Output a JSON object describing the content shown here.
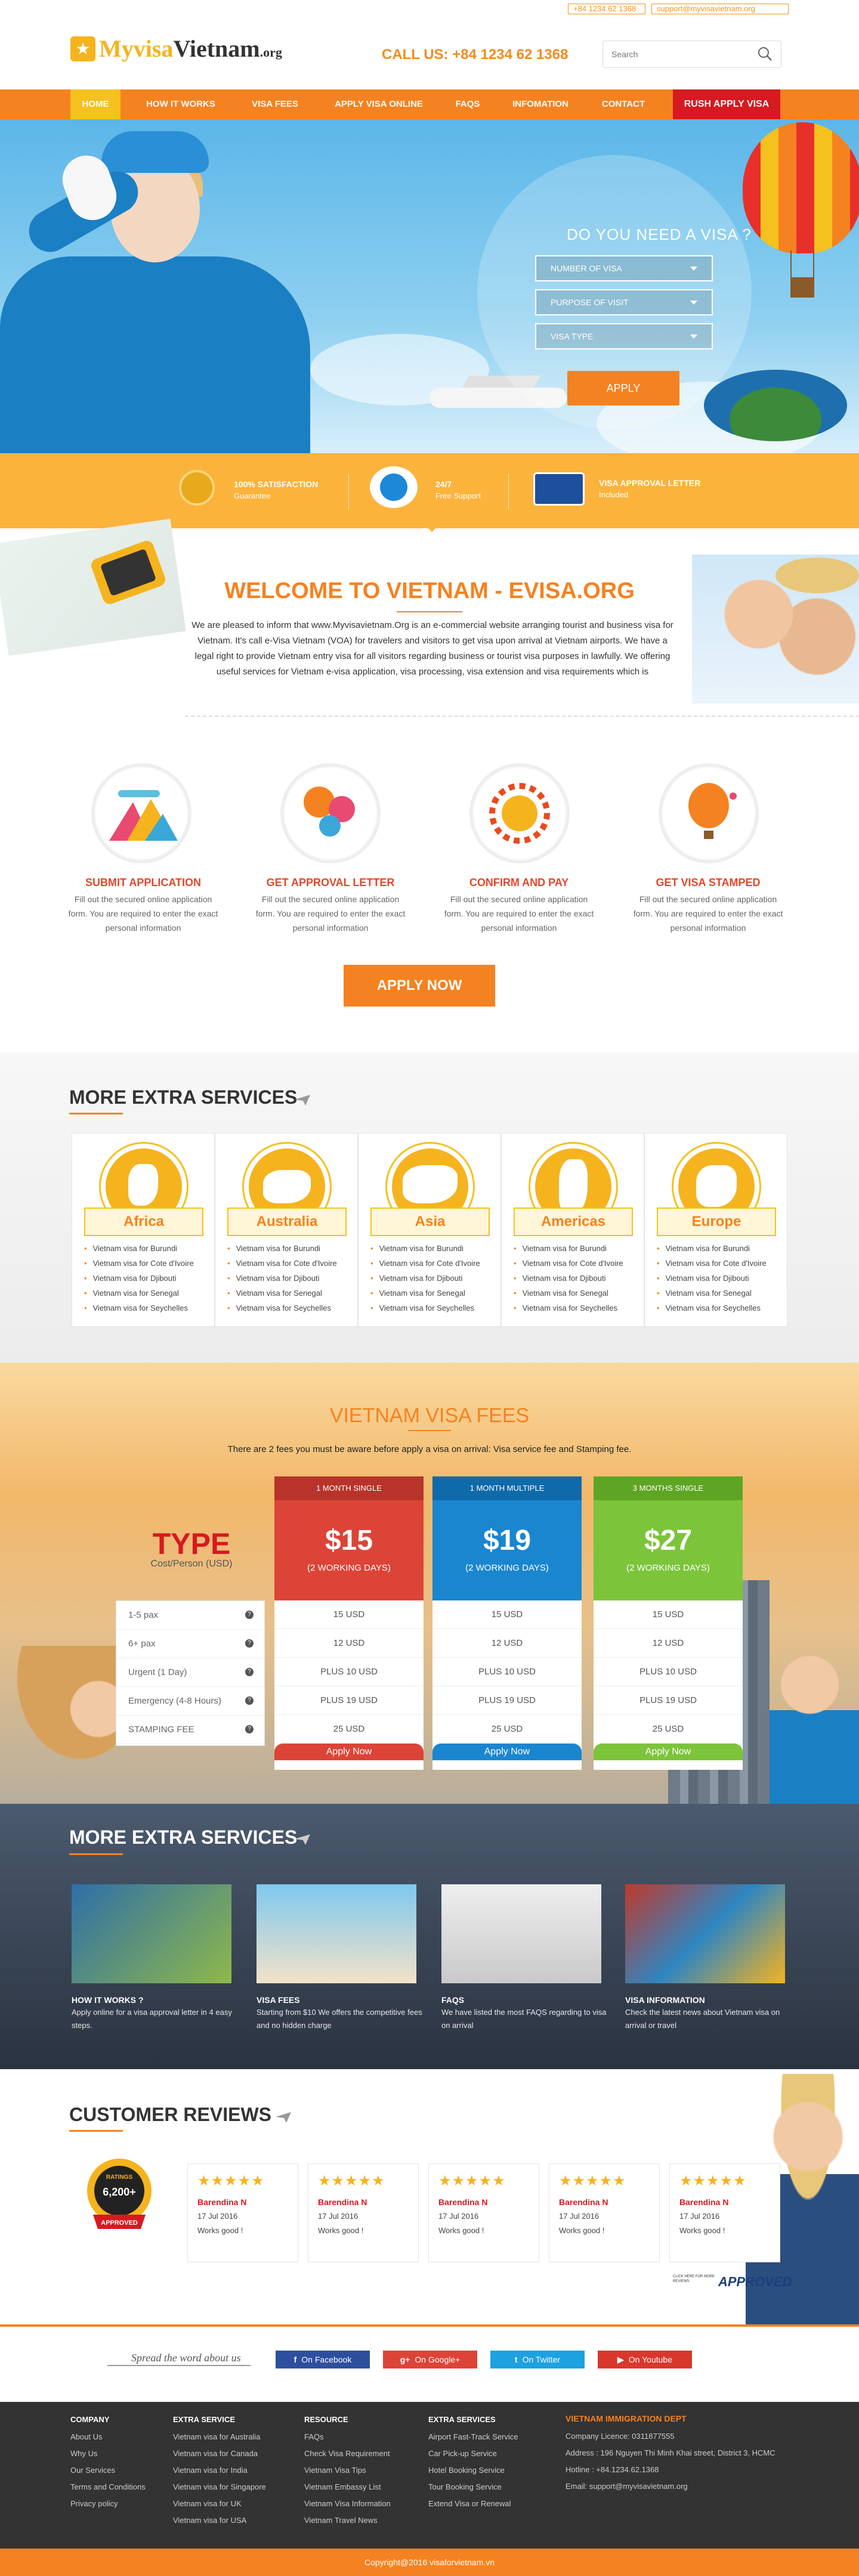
{
  "topbar": {
    "phone": "+84 1234 62 1368",
    "email": "support@myvisavietnam.org"
  },
  "logo": {
    "brand_a": "Myvisa",
    "brand_b": "Vietnam",
    "suffix": ".org"
  },
  "header": {
    "call_us": "CALL US: +84 1234 62 1368",
    "search_placeholder": "Search"
  },
  "nav": {
    "items": [
      "HOME",
      "HOW IT WORKS",
      "VISA FEES",
      "APPLY VISA ONLINE",
      "FAQS",
      "INFOMATION",
      "CONTACT"
    ],
    "rush": "RUSH APPLY VISA"
  },
  "hero": {
    "title": "DO YOU NEED A VISA ?",
    "fields": [
      "NUMBER OF VISA",
      "PURPOSE OF VISIT",
      "VISA TYPE"
    ],
    "apply": "APPLY"
  },
  "features": [
    {
      "title": "100% SATISFACTION",
      "sub": "Guarantee",
      "icon": "medal-icon"
    },
    {
      "title": "24/7",
      "sub": "Free Support",
      "icon": "support-icon"
    },
    {
      "title": "VISA APPROVAL LETTER",
      "sub": "Included",
      "icon": "credit-card-icon"
    }
  ],
  "welcome": {
    "title": "WELCOME TO VIETNAM - EVISA.ORG",
    "text": "We are pleased to inform that www.Myvisavietnam.Org is an e-commercial website arranging tourist and business visa for Vietnam. It's call e-Visa Vietnam (VOA) for travelers and visitors to get visa upon arrival at Vietnam airports. We have a legal right to provide Vietnam entry visa for all visitors regarding business or tourist visa purposes in lawfully. We offering useful services for Vietnam e-visa application, visa processing, visa extension and visa requirements which is"
  },
  "steps": [
    {
      "title": "SUBMIT APPLICATION",
      "text": "Fill out the secured online application form. You are required to enter the exact personal information"
    },
    {
      "title": "GET APPROVAL LETTER",
      "text": "Fill out the secured online application form. You are required to enter the exact personal information"
    },
    {
      "title": "CONFIRM AND PAY",
      "text": "Fill out the secured online application form. You are required to enter the exact personal information"
    },
    {
      "title": "GET VISA STAMPED",
      "text": "Fill out the secured online application form. You are required to enter the exact personal information"
    }
  ],
  "apply_now": "APPLY NOW",
  "extra_services": {
    "title": "MORE EXTRA SERVICES",
    "regions": [
      {
        "name": "Africa",
        "links": [
          "Vietnam visa for Burundi",
          "Vietnam visa for Cote d'Ivoire",
          "Vietnam visa for Djibouti",
          "Vietnam visa for Senegal",
          "Vietnam visa for Seychelles"
        ]
      },
      {
        "name": "Australia",
        "links": [
          "Vietnam visa for Burundi",
          "Vietnam visa for Cote d'Ivoire",
          "Vietnam visa for Djibouti",
          "Vietnam visa for Senegal",
          "Vietnam visa for Seychelles"
        ]
      },
      {
        "name": "Asia",
        "links": [
          "Vietnam visa for Burundi",
          "Vietnam visa for Cote d'Ivoire",
          "Vietnam visa for Djibouti",
          "Vietnam visa for Senegal",
          "Vietnam visa for Seychelles"
        ]
      },
      {
        "name": "Americas",
        "links": [
          "Vietnam visa for Burundi",
          "Vietnam visa for Cote d'Ivoire",
          "Vietnam visa for Djibouti",
          "Vietnam visa for Senegal",
          "Vietnam visa for Seychelles"
        ]
      },
      {
        "name": "Europe",
        "links": [
          "Vietnam visa for Burundi",
          "Vietnam visa for Cote d'Ivoire",
          "Vietnam visa for Djibouti",
          "Vietnam visa for Senegal",
          "Vietnam visa for Seychelles"
        ]
      }
    ]
  },
  "fees": {
    "title": "VIETNAM VISA FEES",
    "sub": "There are 2 fees you must be aware before apply a visa on arrival: Visa service fee and Stamping fee.",
    "type_title": "TYPE",
    "type_sub": "Cost/Person (USD)",
    "rows": [
      "1-5 pax",
      "6+ pax",
      "Urgent (1 Day)",
      "Emergency (4-8 Hours)",
      "STAMPING FEE"
    ],
    "plans": [
      {
        "name": "1 MONTH SINGLE",
        "price": "$15",
        "days": "(2 WORKING DAYS)",
        "values": [
          "15 USD",
          "12 USD",
          "PLUS 10 USD",
          "PLUS 19 USD",
          "25 USD"
        ],
        "button": "Apply Now",
        "color": "#dc4437",
        "head_color": "#b8332a"
      },
      {
        "name": "1 MONTH MULTIPLE",
        "price": "$19",
        "days": "(2 WORKING DAYS)",
        "values": [
          "15 USD",
          "12 USD",
          "PLUS 10 USD",
          "PLUS 19 USD",
          "25 USD"
        ],
        "button": "Apply Now",
        "color": "#1a86d0",
        "head_color": "#0f6aaa"
      },
      {
        "name": "3 MONTHS SINGLE",
        "price": "$27",
        "days": "(2 WORKING DAYS)",
        "values": [
          "15 USD",
          "12 USD",
          "PLUS 10 USD",
          "PLUS 19 USD",
          "25 USD"
        ],
        "button": "Apply Now",
        "color": "#7cc43a",
        "head_color": "#5fa524"
      }
    ]
  },
  "extra_services_2": {
    "title": "MORE EXTRA SERVICES",
    "tiles": [
      {
        "title": "HOW IT WORKS ?",
        "text": "Apply online for a visa approval letter in 4 easy steps."
      },
      {
        "title": "VISA FEES",
        "text": "Starting from $10 We offers the competitive fees and no hidden charge"
      },
      {
        "title": "FAQS",
        "text": "We have listed the most FAQS regarding to visa on arrival"
      },
      {
        "title": "VISA INFORMATION",
        "text": "Check the latest news about Vietnam visa on arrival or travel"
      }
    ]
  },
  "reviews": {
    "title": "CUSTOMER REVIEWS",
    "badge": {
      "top": "RATINGS",
      "count": "6,200+",
      "bottom": "APPROVED"
    },
    "items": [
      {
        "stars": "★★★★★",
        "name": "Barendina N",
        "date": "17 Jul 2016",
        "text": "Works good !"
      },
      {
        "stars": "★★★★★",
        "name": "Barendina N",
        "date": "17 Jul 2016",
        "text": "Works good !"
      },
      {
        "stars": "★★★★★",
        "name": "Barendina N",
        "date": "17 Jul 2016",
        "text": "Works good !"
      },
      {
        "stars": "★★★★★",
        "name": "Barendina N",
        "date": "17 Jul 2016",
        "text": "Works good !"
      },
      {
        "stars": "★★★★★",
        "name": "Barendina N",
        "date": "17 Jul 2016",
        "text": "Works good !"
      }
    ],
    "approved_caption": "CLICK HERE FOR MORE REVIEWS",
    "approved_logo": "APPROVED"
  },
  "social": {
    "spread": "Spread the word about us",
    "buttons": [
      {
        "label": "On Facebook",
        "color": "#2d4f9e"
      },
      {
        "label": "On Google+",
        "color": "#dc4437"
      },
      {
        "label": "On Twitter",
        "color": "#1ea1e0"
      },
      {
        "label": "On Youtube",
        "color": "#d8382c"
      }
    ]
  },
  "footer": {
    "columns": [
      {
        "title": "COMPANY",
        "links": [
          "About Us",
          "Why Us",
          "Our Services",
          "Terms and Conditions",
          "Privacy policy"
        ]
      },
      {
        "title": "EXTRA SERVICE",
        "links": [
          "Vietnam visa for Australia",
          "Vietnam visa for Canada",
          "Vietnam visa for India",
          "Vietnam visa for Singapore",
          "Vietnam visa for UK",
          "Vietnam visa for USA"
        ]
      },
      {
        "title": "RESOURCE",
        "links": [
          "FAQs",
          "Check Visa Requirement",
          "Vietnam Visa Tips",
          "Vietnam Embassy List",
          "Vietnam Visa Information",
          "Vietnam Travel News"
        ]
      },
      {
        "title": "EXTRA SERVICES",
        "links": [
          "Airport Fast-Track Service",
          "Car Pick-up Service",
          "Hotel Booking Service",
          "Tour Booking Service",
          "Extend Visa or Renewal"
        ]
      }
    ],
    "dept": {
      "title": "VIETNAM IMMIGRATION DEPT",
      "lines": [
        "Company Licence: 0311877555",
        "Address : 196 Nguyen Thi Minh Khai street, District 3, HCMC",
        "Hotline : +84.1234.62.1368",
        "Email: support@myvisavietnam.org"
      ]
    },
    "copyright": "Copyright@2016 visaforvietnam.vn"
  }
}
